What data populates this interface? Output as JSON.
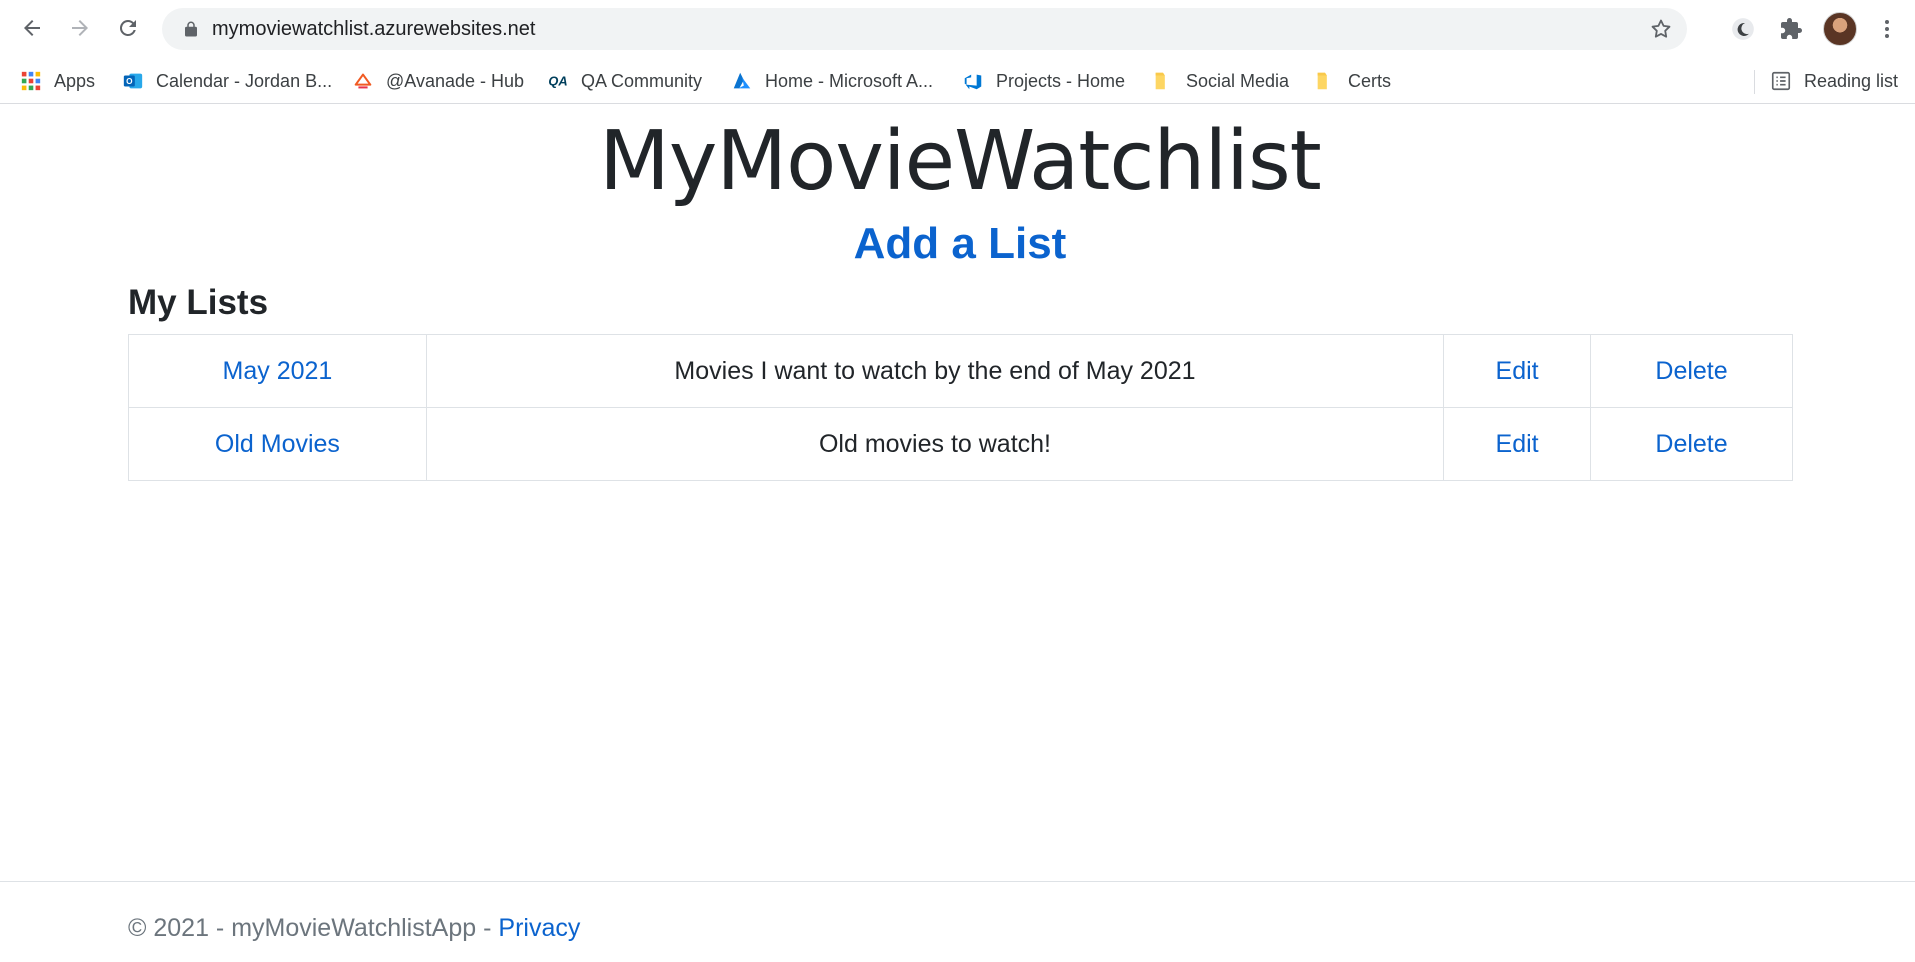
{
  "browser": {
    "url": "mymoviewatchlist.azurewebsites.net",
    "bookmarks": [
      {
        "label": "Apps",
        "icon": "apps-grid-icon"
      },
      {
        "label": "Calendar - Jordan B...",
        "icon": "outlook-icon"
      },
      {
        "label": "@Avanade - Hub",
        "icon": "avanade-icon"
      },
      {
        "label": "QA Community",
        "icon": "qa-icon"
      },
      {
        "label": "Home - Microsoft A...",
        "icon": "azure-icon"
      },
      {
        "label": "Projects - Home",
        "icon": "devops-icon"
      },
      {
        "label": "Social Media",
        "icon": "folder-icon"
      },
      {
        "label": "Certs",
        "icon": "folder-icon"
      }
    ],
    "reading_list": "Reading list"
  },
  "page": {
    "title": "MyMovieWatchlist",
    "add_list": "Add a List",
    "section_heading": "My Lists",
    "lists": [
      {
        "name": "May 2021",
        "description": "Movies I want to watch by the end of May 2021",
        "edit": "Edit",
        "delete": "Delete"
      },
      {
        "name": "Old Movies",
        "description": "Old movies to watch!",
        "edit": "Edit",
        "delete": "Delete"
      }
    ]
  },
  "footer": {
    "copyright": "© 2021 - myMovieWatchlistApp - ",
    "privacy": "Privacy"
  },
  "colors": {
    "link": "#0b63ce",
    "text": "#212529",
    "muted": "#6c757d",
    "border": "#dee2e6"
  }
}
